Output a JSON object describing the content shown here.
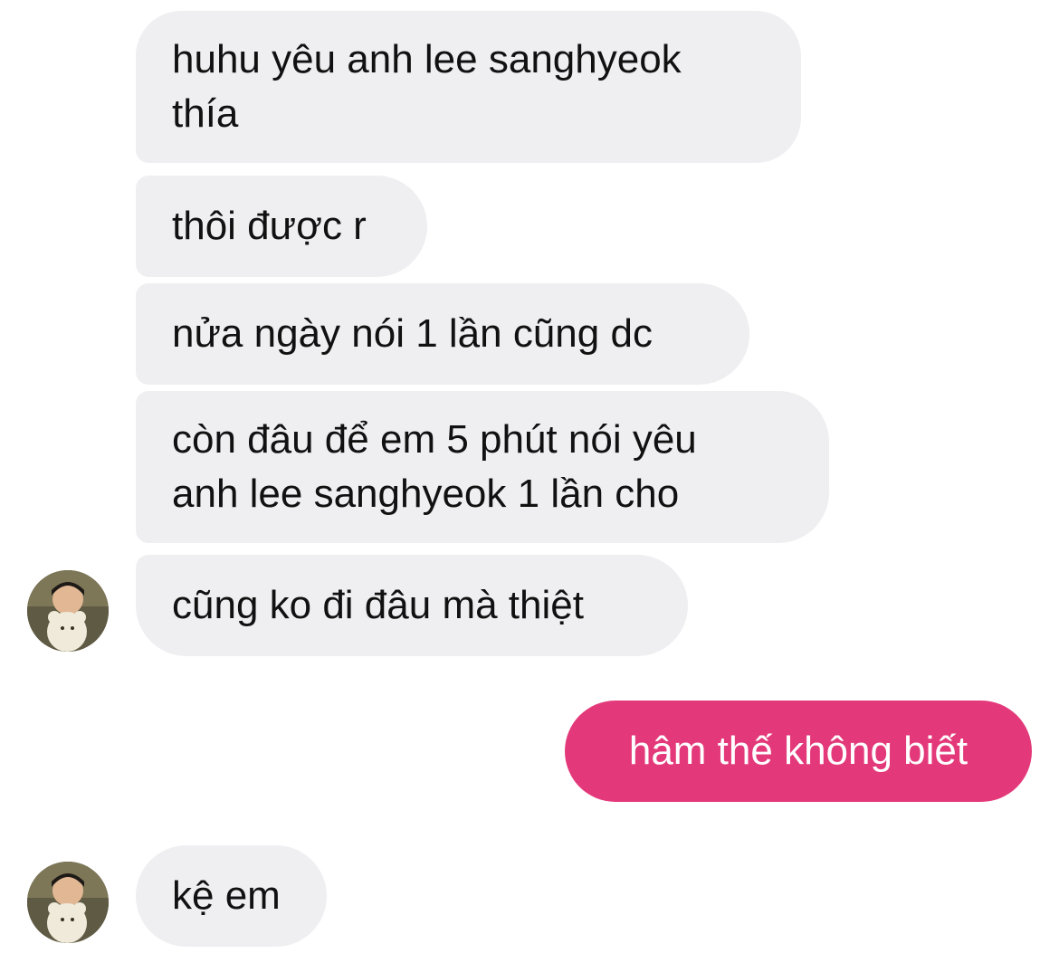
{
  "conversation": {
    "messages": [
      {
        "sender": "other",
        "text": "huhu yêu anh lee sanghyeok\nthía"
      },
      {
        "sender": "other",
        "text": "thôi được r"
      },
      {
        "sender": "other",
        "text": "nửa ngày nói 1 lần cũng dc"
      },
      {
        "sender": "other",
        "text": "còn đâu để em 5 phút nói yêu\nanh lee sanghyeok 1 lần cho"
      },
      {
        "sender": "other",
        "text": "cũng ko đi đâu mà thiệt"
      },
      {
        "sender": "me",
        "text": "hâm thế không biết"
      },
      {
        "sender": "other",
        "text": "kệ em"
      }
    ]
  },
  "colors": {
    "incoming_bubble": "#efeff2",
    "outgoing_bubble": "#e3397a",
    "text": "#111111",
    "outgoing_text": "#ffffff"
  },
  "icons": {
    "avatar": "contact-avatar-icon"
  }
}
